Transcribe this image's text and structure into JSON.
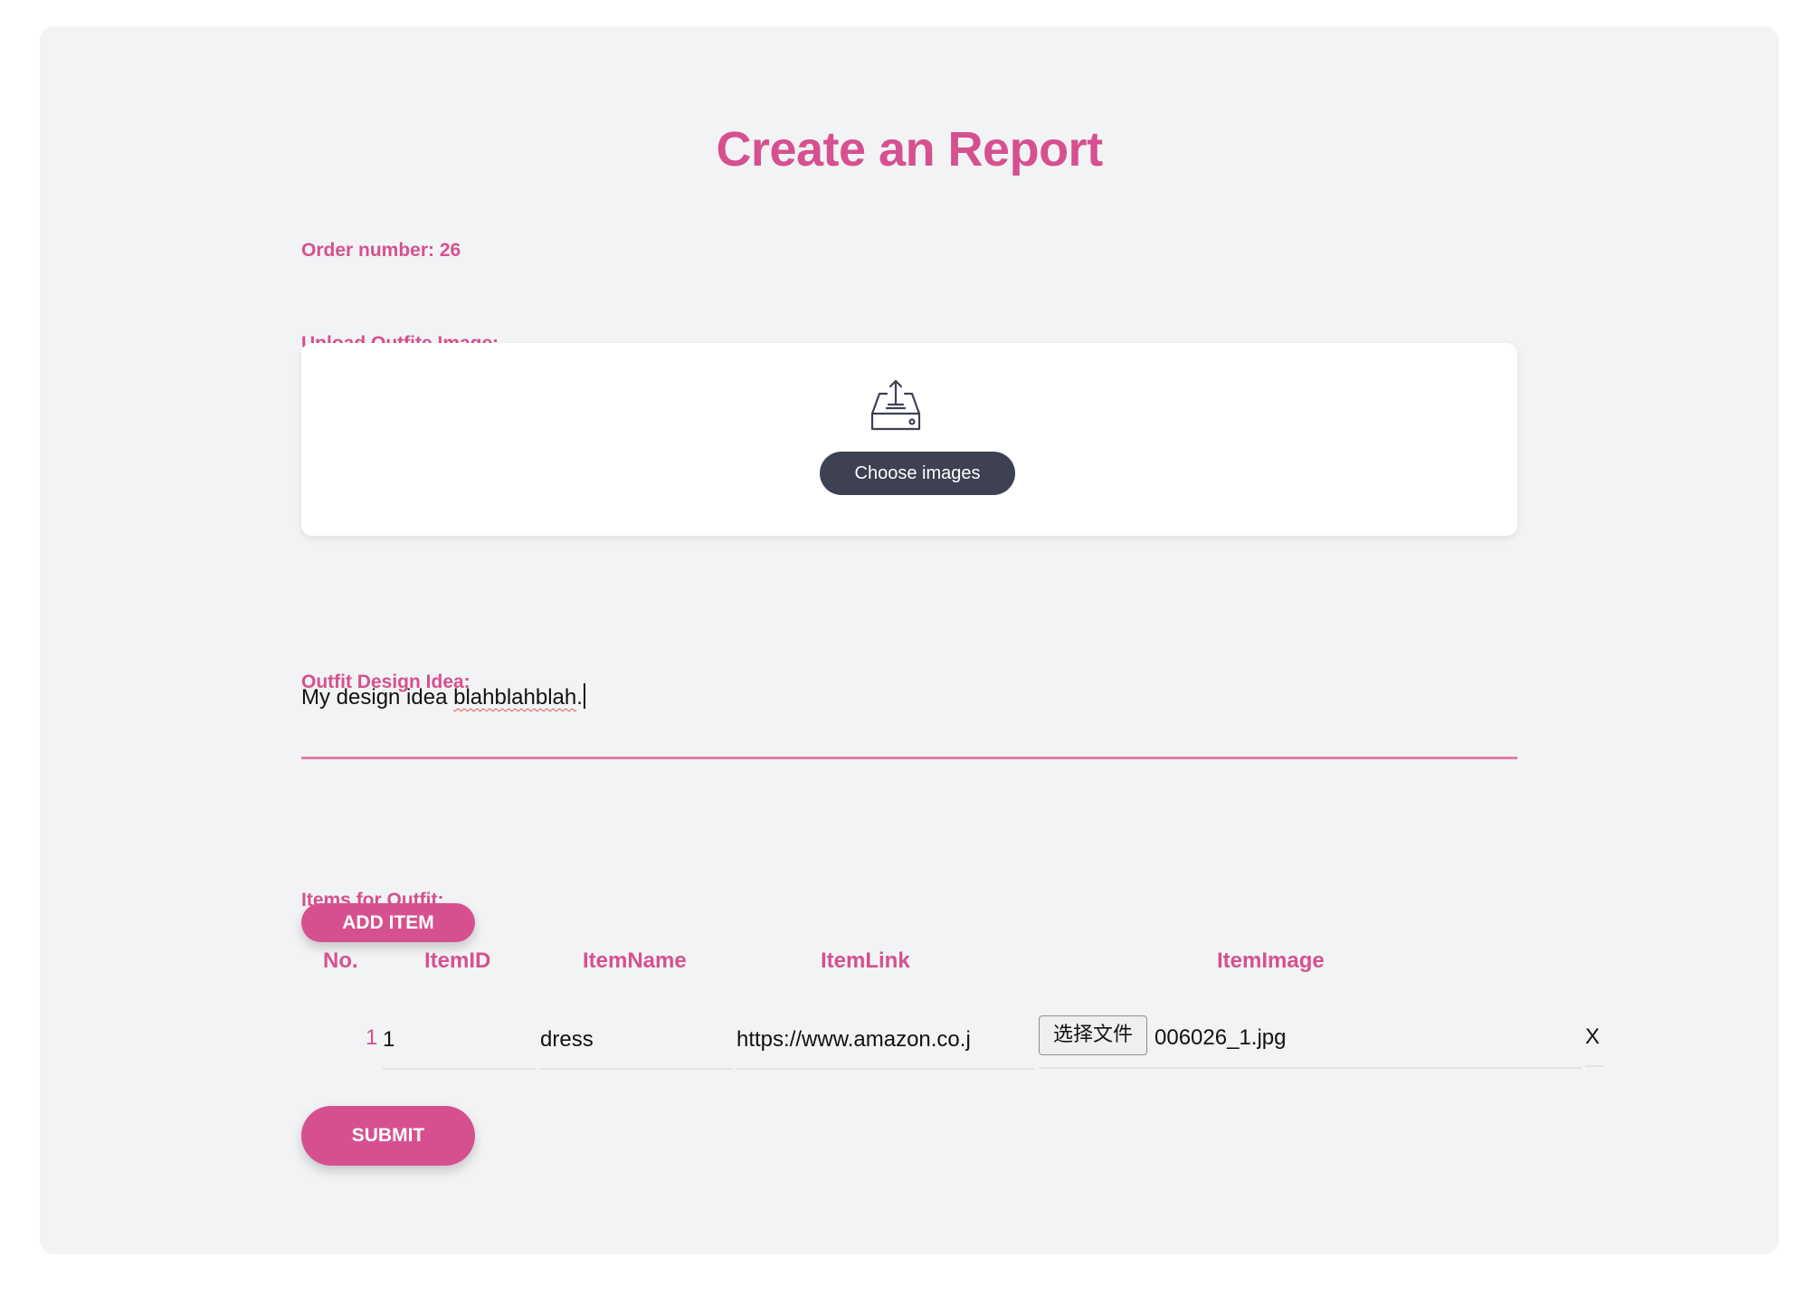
{
  "page": {
    "title": "Create an Report",
    "order_label": "Order number: 26"
  },
  "upload": {
    "label": "Upload Outfite Image:",
    "icon": "upload-tray-icon",
    "button_label": "Choose images"
  },
  "idea": {
    "label": "Outfit Design Idea:",
    "value_prefix": "My design idea ",
    "value_misspelled": "blahblahblah",
    "value_suffix": "."
  },
  "items": {
    "label": "Items for Outfit:",
    "add_button": "ADD ITEM",
    "columns": [
      "No.",
      "ItemID",
      "ItemName",
      "ItemLink",
      "ItemImage"
    ],
    "rows": [
      {
        "no": "1",
        "item_id": "1",
        "item_name": "dress",
        "item_link": "https://www.amazon.co.j",
        "file_button": "选择文件",
        "file_name": "006026_1.jpg",
        "remove": "X"
      }
    ]
  },
  "submit_button": "SUBMIT",
  "colors": {
    "accent": "#d6508f",
    "panel_bg": "#f2f3f5",
    "dark_button": "#3d4152"
  }
}
